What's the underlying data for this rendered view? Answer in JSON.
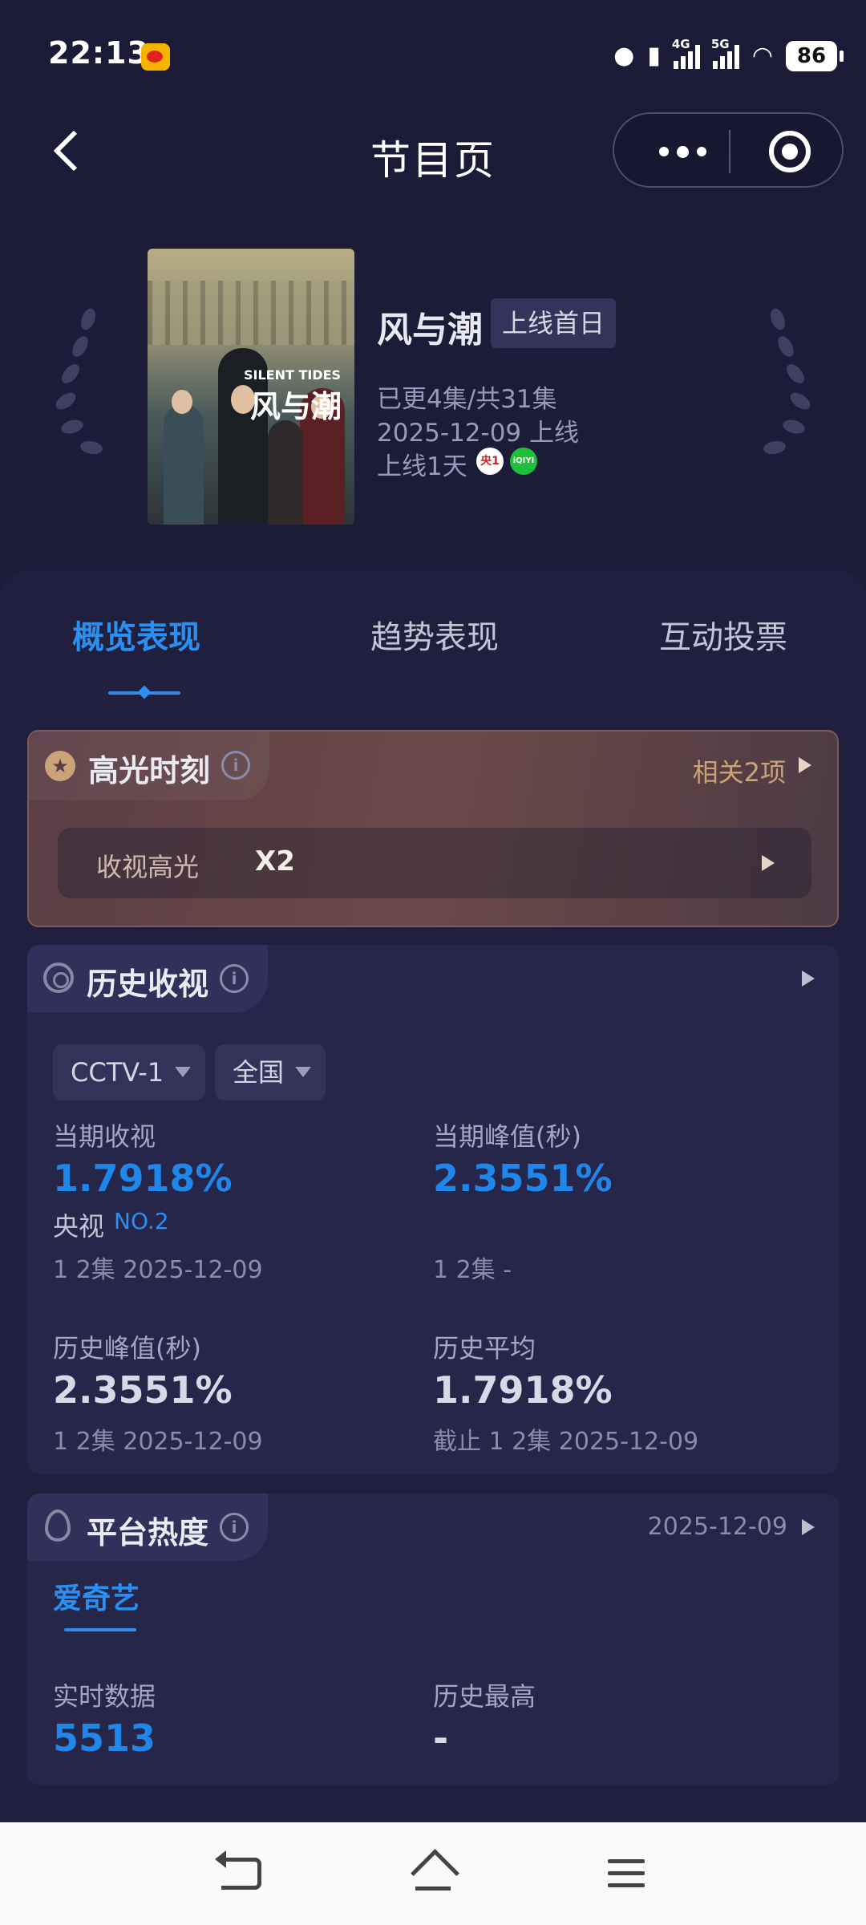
{
  "status_bar": {
    "time": "22:13",
    "net1": "4G",
    "net2": "5G",
    "battery": "86"
  },
  "nav": {
    "title": "节目页"
  },
  "show": {
    "poster_title_en": "SILENT TIDES",
    "poster_title_cn": "风与潮",
    "title": "风与潮",
    "badge": "上线首日",
    "episodes": "已更4集/共31集",
    "release": "2025-12-09 上线",
    "days_online": "上线1天",
    "platform_icons": [
      "cctv1-icon",
      "iqiyi-icon"
    ],
    "cctv_icon_text": "央1",
    "iqiyi_icon_text": "iQIYI"
  },
  "tabs": [
    "概览表现",
    "趋势表现",
    "互动投票"
  ],
  "highlights": {
    "title": "高光时刻",
    "related": "相关2项",
    "item_label": "收视高光",
    "item_value": "X2"
  },
  "ratings": {
    "title": "历史收视",
    "channel": "CCTV-1",
    "region": "全国",
    "current_label": "当期收视",
    "current_value": "1.7918%",
    "rank_label": "央视",
    "rank_value": "NO.2",
    "current_sub": "1 2集 2025-12-09",
    "peak_label": "当期峰值(秒)",
    "peak_value": "2.3551%",
    "peak_sub": "1 2集 -",
    "hist_peak_label": "历史峰值(秒)",
    "hist_peak_value": "2.3551%",
    "hist_peak_sub": "1 2集 2025-12-09",
    "hist_avg_label": "历史平均",
    "hist_avg_value": "1.7918%",
    "hist_avg_sub": "截止 1 2集 2025-12-09"
  },
  "heat": {
    "title": "平台热度",
    "date": "2025-12-09",
    "platform": "爱奇艺",
    "realtime_label": "实时数据",
    "realtime_value": "5513",
    "hist_max_label": "历史最高",
    "hist_max_value": "-"
  },
  "colors": {
    "accent": "#2a8ff0",
    "background": "#1c1c38",
    "highlight_gold": "#caa478"
  }
}
